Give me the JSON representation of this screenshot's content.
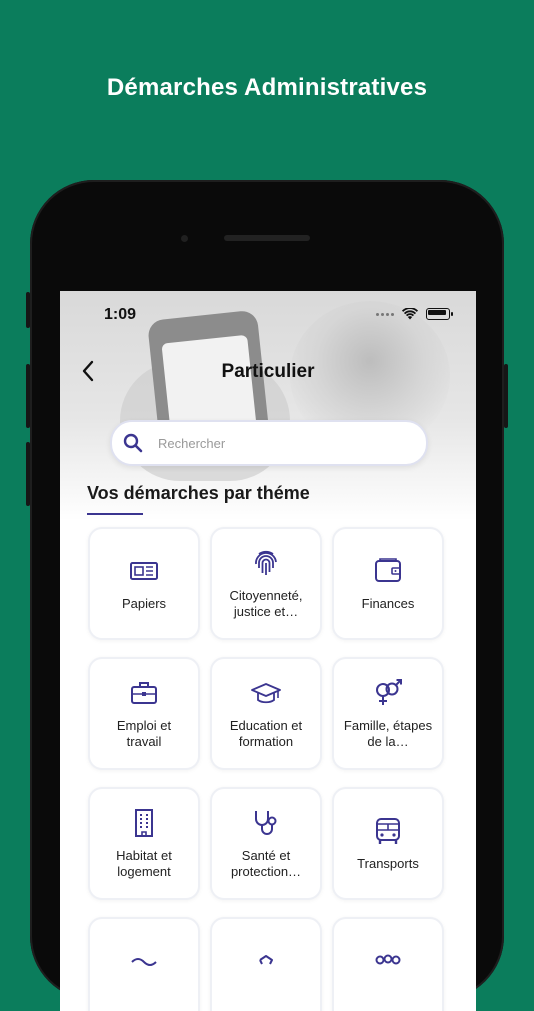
{
  "headline": "Démarches Administratives",
  "status_bar": {
    "time": "1:09"
  },
  "nav": {
    "title": "Particulier"
  },
  "search": {
    "placeholder": "Rechercher"
  },
  "section": {
    "title": "Vos démarches par théme"
  },
  "themes": [
    {
      "label": "Papiers",
      "icon": "newspaper-icon"
    },
    {
      "label": "Citoyenneté, justice et…",
      "icon": "fingerprint-icon"
    },
    {
      "label": "Finances",
      "icon": "wallet-icon"
    },
    {
      "label": "Emploi et travail",
      "icon": "briefcase-icon"
    },
    {
      "label": "Education et formation",
      "icon": "graduation-cap-icon"
    },
    {
      "label": "Famille, étapes de la…",
      "icon": "gender-icon"
    },
    {
      "label": "Habitat et logement",
      "icon": "building-icon"
    },
    {
      "label": "Santé et protection…",
      "icon": "stethoscope-icon"
    },
    {
      "label": "Transports",
      "icon": "bus-icon"
    },
    {
      "label": "",
      "icon": "scale-icon"
    },
    {
      "label": "",
      "icon": "hands-icon"
    },
    {
      "label": "",
      "icon": "people-icon"
    }
  ],
  "colors": {
    "background": "#0b7d5c",
    "accent": "#3b3590"
  }
}
